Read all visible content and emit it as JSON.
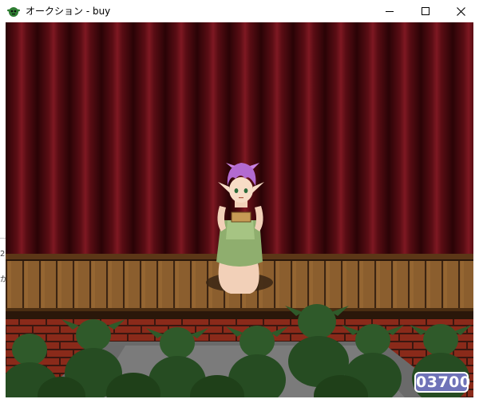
{
  "window": {
    "title": "オークション - buy",
    "icon": "goblin-head-icon",
    "controls": {
      "minimize": "minimize-icon",
      "maximize": "maximize-icon",
      "close": "close-icon"
    }
  },
  "desktop_fragments": [
    "2(",
    "か"
  ],
  "game": {
    "score": "03700",
    "colors": {
      "curtain_dark": "#3a0508",
      "curtain_light": "#7a1520",
      "stage_floor": "#8b5e2e",
      "stage_plank_line": "#3b2412",
      "brick": "#8a2a1a",
      "goblin_green": "#2f5a2a",
      "score_bg": "#6f73b8"
    }
  }
}
